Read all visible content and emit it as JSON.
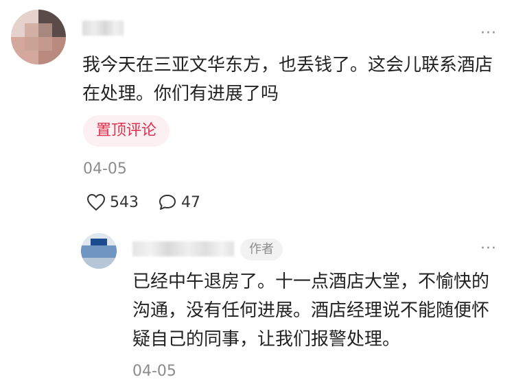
{
  "comment": {
    "text": "我今天在三亚文华东方，也丢钱了。这会儿联系酒店在处理。你们有进展了吗",
    "pin_label": "置顶评论",
    "date": "04-05",
    "like_count": "543",
    "reply_count": "47",
    "more": "···"
  },
  "reply": {
    "author_tag": "作者",
    "text": "已经中午退房了。十一点酒店大堂，不愉快的沟通，没有任何进展。酒店经理说不能随便怀疑自己的同事，让我们报警处理。",
    "date": "04-05",
    "more": "···"
  },
  "colors": {
    "pin_bg": "#fdf0f2",
    "pin_text": "#e0304e",
    "muted": "#8c8c8c"
  },
  "icons": {
    "like": "heart-outline-icon",
    "comment": "speech-bubble-icon",
    "more": "ellipsis-icon"
  }
}
